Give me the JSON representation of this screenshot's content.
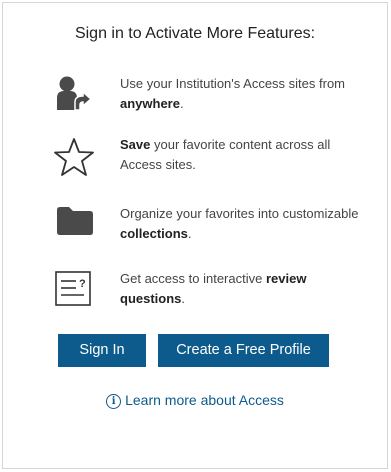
{
  "heading": "Sign in to Activate More Features:",
  "features": [
    {
      "icon": "remote-access-user-icon",
      "pre": "Use your Institution's Access sites from ",
      "bold": "anywhere",
      "post": "."
    },
    {
      "icon": "star-icon",
      "bold_first": "Save",
      "rest": " your favorite content across all Access sites."
    },
    {
      "icon": "folder-icon",
      "pre": "Organize your favorites into customizable ",
      "bold": "collections",
      "post": "."
    },
    {
      "icon": "review-questions-icon",
      "pre": "Get access to interactive ",
      "bold": "review questions",
      "post": "."
    }
  ],
  "buttons": {
    "sign_in": "Sign In",
    "create_profile": "Create a Free Profile"
  },
  "learn_more": {
    "icon": "info-icon",
    "icon_glyph": "i",
    "label": "Learn more about Access"
  },
  "colors": {
    "accent": "#0d5a8c",
    "icon_gray": "#4a4a4a"
  }
}
